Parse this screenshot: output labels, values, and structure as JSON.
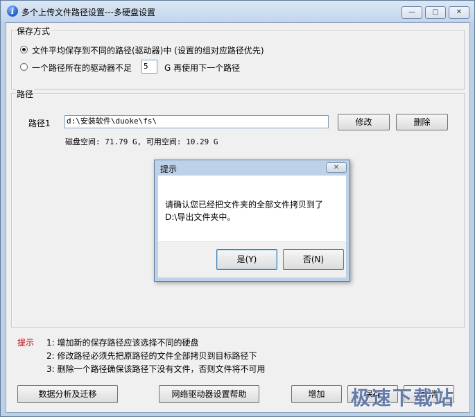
{
  "window": {
    "title": "多个上传文件路径设置---多硬盘设置",
    "app_icon_glyph": "i",
    "minimize_glyph": "—",
    "maximize_glyph": "▢",
    "close_glyph": "✕"
  },
  "save_mode": {
    "legend": "保存方式",
    "option1_label": "文件平均保存到不同的路径(驱动器)中  (设置的组对应路径优先)",
    "option1_selected": true,
    "option2_label_prefix": "一个路径所在的驱动器不足",
    "option2_value": "5",
    "option2_label_suffix": "G 再使用下一个路径",
    "option2_selected": false
  },
  "paths": {
    "legend": "路径",
    "path1_label": "路径1",
    "path1_value": "d:\\安装软件\\duoke\\fs\\",
    "modify_button": "修改",
    "delete_button": "删除",
    "disk_info": "磁盘空间: 71.79 G, 可用空间: 10.29 G"
  },
  "hints": {
    "title": "提示",
    "items": [
      "1: 增加新的保存路径应该选择不同的硬盘",
      "2: 修改路径必须先把原路径的文件全部拷贝到目标路径下",
      "3: 删除一个路径确保该路径下没有文件，否则文件将不可用"
    ]
  },
  "bottom_buttons": {
    "data_migrate": "数据分析及迁移",
    "network_help": "网络驱动器设置帮助",
    "add": "增加",
    "save": "保存",
    "cancel": "取消"
  },
  "dialog": {
    "title": "提示",
    "close_glyph": "✕",
    "message_line1": "请确认您已经把文件夹的全部文件拷贝到了",
    "message_line2": "D:\\导出文件夹中。",
    "yes_button": "是(Y)",
    "no_button": "否(N)"
  },
  "watermark": "极速下载站"
}
